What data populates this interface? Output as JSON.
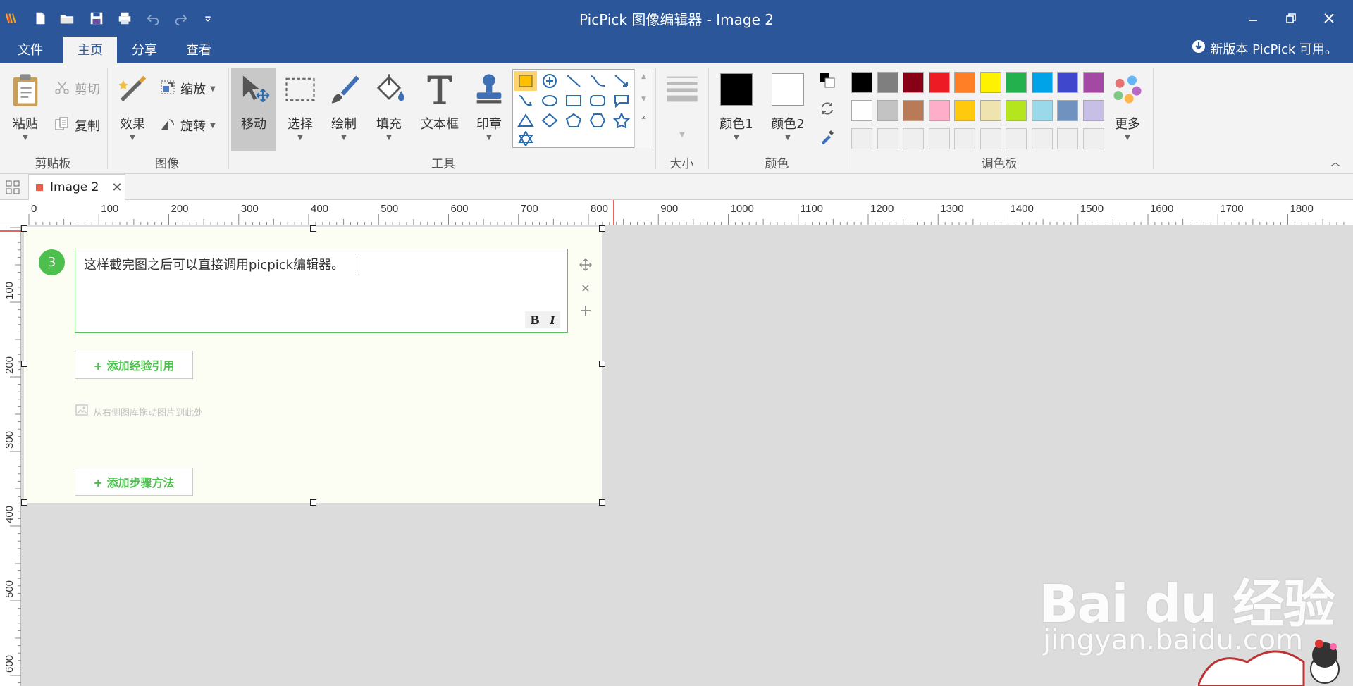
{
  "app": {
    "title": "PicPick 图像编辑器 - Image 2"
  },
  "menubar": {
    "items": [
      {
        "label": "文件"
      },
      {
        "label": "主页",
        "active": true
      },
      {
        "label": "分享"
      },
      {
        "label": "查看"
      }
    ],
    "update_notice": "新版本 PicPick 可用。"
  },
  "ribbon": {
    "clipboard": {
      "paste": "粘贴",
      "cut": "剪切",
      "copy": "复制",
      "group": "剪贴板"
    },
    "image": {
      "effects": "效果",
      "zoom": "缩放",
      "rotate": "旋转",
      "group": "图像"
    },
    "tools": {
      "move": "移动",
      "select": "选择",
      "draw": "绘制",
      "fill": "填充",
      "textbox": "文本框",
      "stamp": "印章",
      "group": "工具"
    },
    "size": {
      "group": "大小"
    },
    "colors": {
      "color1": "颜色1",
      "color2": "颜色2",
      "group": "颜色",
      "color1_value": "#000000",
      "color2_value": "#ffffff"
    },
    "palette": {
      "group": "调色板",
      "more": "更多",
      "row1": [
        "#000000",
        "#7f7f7f",
        "#880015",
        "#ed1c24",
        "#ff7f27",
        "#fff200",
        "#22b14c",
        "#00a2e8",
        "#3f48cc",
        "#a349a4"
      ],
      "row2": [
        "#ffffff",
        "#c3c3c3",
        "#b97a57",
        "#ffaec9",
        "#ffc90e",
        "#efe4b0",
        "#b5e61d",
        "#99d9ea",
        "#7092be",
        "#c8bfe7"
      ]
    }
  },
  "tabs": {
    "doc_tab": "Image 2"
  },
  "rulers": {
    "top": [
      "0",
      "100",
      "200",
      "300",
      "400",
      "500",
      "600",
      "700",
      "800",
      "900",
      "1000",
      "1100",
      "1200",
      "1300",
      "1400",
      "1500",
      "1600",
      "1700",
      "1800"
    ],
    "left": [
      "100",
      "200",
      "300",
      "400",
      "500",
      "600"
    ]
  },
  "canvas": {
    "step_number": "3",
    "editor_text": "这样截完图之后可以直接调用picpick编辑器。",
    "bold": "B",
    "italic": "I",
    "add_reference": "+ 添加经验引用",
    "image_hint": "从右侧图库拖动图片到此处",
    "add_step": "+ 添加步骤方法"
  },
  "watermark": {
    "brand": "Bai du 经验",
    "url": "jingyan.baidu.com"
  }
}
